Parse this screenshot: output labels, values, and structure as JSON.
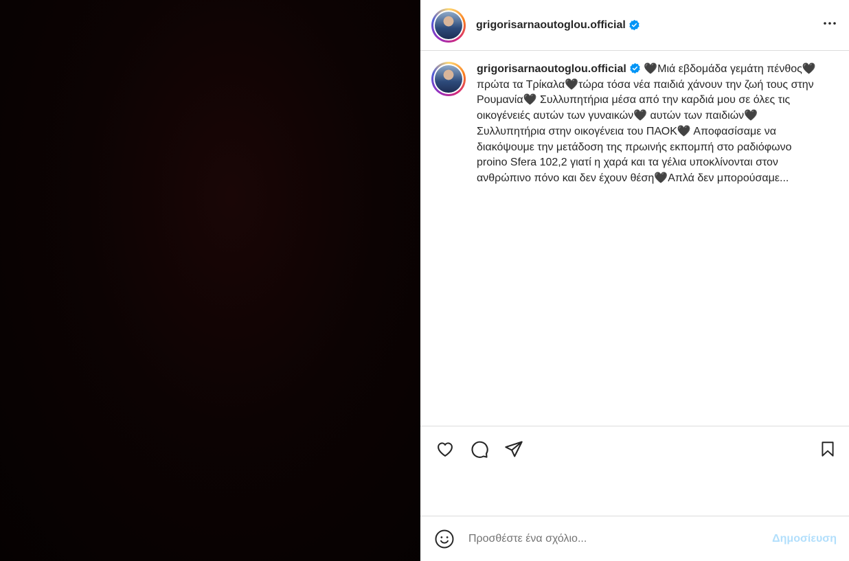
{
  "post": {
    "username": "grigorisarnaoutoglou.official",
    "verified": true,
    "caption_username": "grigorisarnaoutoglou.official",
    "caption_text": " 🖤Μιά εβδομάδα γεμάτη πένθος🖤πρώτα τα Τρίκαλα🖤τώρα τόσα νέα παιδιά χάνουν την ζωή τους στην Ρουμανία🖤 Συλλυπητήρια μέσα από την καρδιά μου σε όλες τις οικογένειές αυτών των γυναικών🖤 αυτών των παιδιών🖤 Συλλυπητήρια στην οικογένεια του ΠΑΟΚ🖤 Αποφασίσαμε να διακόψουμε την μετάδοση της πρωινής εκπομπή στο ραδιόφωνο proino Sfera 102,2 γιατί η χαρά και τα γέλια υποκλίνονται στον ανθρώπινο πόνο και δεν έχουν θέση🖤Απλά δεν μπορούσαμε..."
  },
  "icons": {
    "more": "more-options-icon",
    "like": "heart-icon",
    "comment": "comment-icon",
    "share": "send-icon",
    "save": "bookmark-icon",
    "emoji": "emoji-icon"
  },
  "comment": {
    "placeholder": "Προσθέστε ένα σχόλιο...",
    "post_label": "Δημοσίευση"
  },
  "colors": {
    "verified": "#0095f6",
    "post_button_disabled": "#b2dffc"
  }
}
